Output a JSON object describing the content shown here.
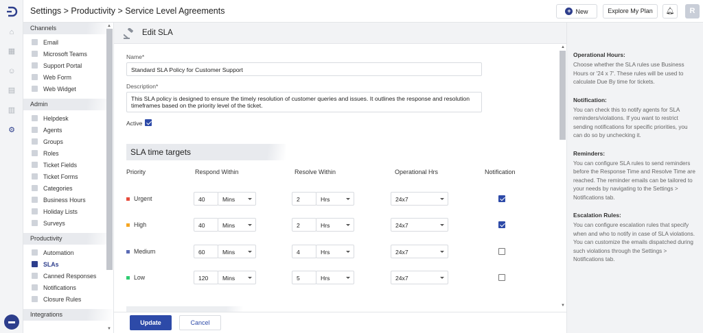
{
  "header": {
    "breadcrumb": "Settings > Productivity > Service Level Agreements",
    "new_label": "New",
    "plan_label": "Explore My Plan",
    "avatar_letter": "R"
  },
  "sidebar": {
    "sections": [
      {
        "title": "Channels",
        "items": [
          "Email",
          "Microsoft Teams",
          "Support Portal",
          "Web Form",
          "Web Widget"
        ]
      },
      {
        "title": "Admin",
        "items": [
          "Helpdesk",
          "Agents",
          "Groups",
          "Roles",
          "Ticket Fields",
          "Ticket Forms",
          "Categories",
          "Business Hours",
          "Holiday Lists",
          "Surveys"
        ]
      },
      {
        "title": "Productivity",
        "items": [
          "Automation",
          "SLAs",
          "Canned Responses",
          "Notifications",
          "Closure Rules"
        ]
      },
      {
        "title": "Integrations",
        "items": []
      }
    ],
    "active_item": "SLAs"
  },
  "page": {
    "title": "Edit SLA",
    "name_label": "Name*",
    "name_value": "Standard SLA Policy for Customer Support",
    "description_label": "Description*",
    "description_value": "This SLA policy is designed to ensure the timely resolution of customer queries and issues. It outlines the response and resolution timeframes based on the priority level of the ticket.",
    "active_label": "Active",
    "active_checked": true,
    "section_title": "SLA time targets",
    "columns": [
      "Priority",
      "Respond Within",
      "Resolve Within",
      "Operational Hrs",
      "Notification"
    ],
    "rows": [
      {
        "priority": "Urgent",
        "color": "#e74c3c",
        "respond": "40",
        "respond_unit": "Mins",
        "resolve": "2",
        "resolve_unit": "Hrs",
        "hours": "24x7",
        "notify": true
      },
      {
        "priority": "High",
        "color": "#f5a623",
        "respond": "40",
        "respond_unit": "Mins",
        "resolve": "2",
        "resolve_unit": "Hrs",
        "hours": "24x7",
        "notify": true
      },
      {
        "priority": "Medium",
        "color": "#5b6bb5",
        "respond": "60",
        "respond_unit": "Mins",
        "resolve": "4",
        "resolve_unit": "Hrs",
        "hours": "24x7",
        "notify": false
      },
      {
        "priority": "Low",
        "color": "#2ecc71",
        "respond": "120",
        "respond_unit": "Mins",
        "resolve": "5",
        "resolve_unit": "Hrs",
        "hours": "24x7",
        "notify": false
      }
    ]
  },
  "footer": {
    "update_label": "Update",
    "cancel_label": "Cancel"
  },
  "help": [
    {
      "title": "Operational Hours:",
      "text": "Choose whether the SLA rules use Business Hours or '24 x 7'. These rules will be used to calculate Due By time for tickets."
    },
    {
      "title": "Notification:",
      "text": "You can check this to notify agents for SLA reminders/violations. If you want to restrict sending notifications for specific priorities, you can do so by unchecking it."
    },
    {
      "title": "Reminders:",
      "text": "You can configure SLA rules to send reminders before the Response Time and Resolve Time are reached. The reminder emails can be tailored to your needs by navigating to the Settings > Notifications tab."
    },
    {
      "title": "Escalation Rules:",
      "text": "You can configure escalation rules that specify when and who to notify in case of SLA violations. You can customize the emails dispatched during such violations through the Settings > Notifications tab."
    }
  ],
  "colors": {
    "brand": "#2d3e8c",
    "accent": "#2d4aa8"
  }
}
